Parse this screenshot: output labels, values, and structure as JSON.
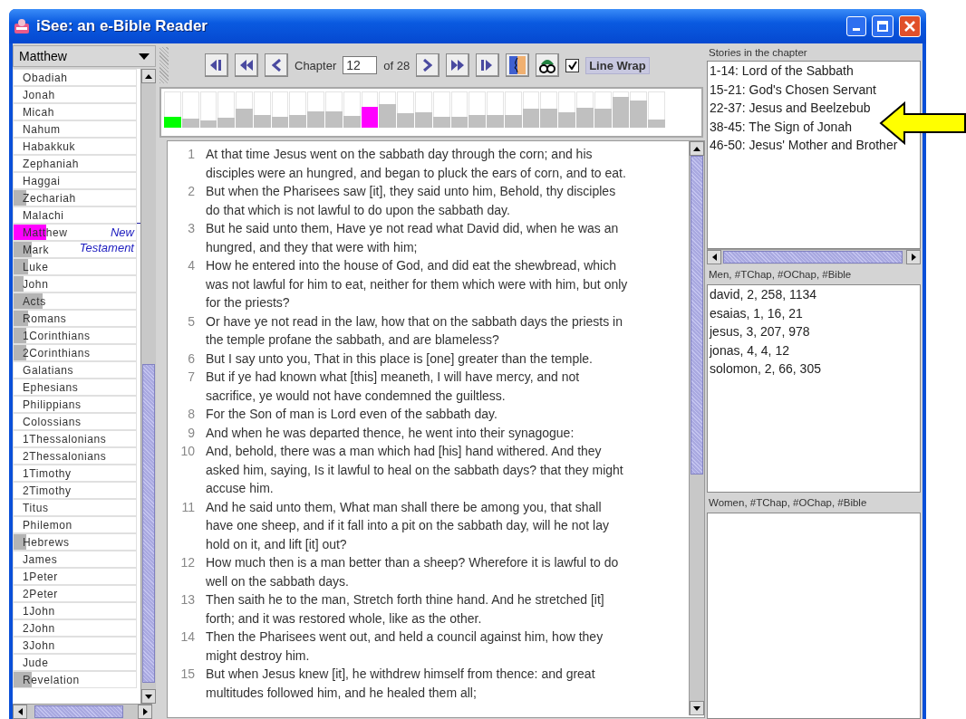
{
  "window": {
    "title": "iSee: an e-Bible Reader"
  },
  "book_selector": {
    "value": "Matthew"
  },
  "books": [
    {
      "name": "Obadiah",
      "selected": false
    },
    {
      "name": "Jonah",
      "selected": false
    },
    {
      "name": "Micah",
      "selected": false
    },
    {
      "name": "Nahum",
      "selected": false
    },
    {
      "name": "Habakkuk",
      "selected": false
    },
    {
      "name": "Zephaniah",
      "selected": false
    },
    {
      "name": "Haggai",
      "selected": false
    },
    {
      "name": "Zechariah",
      "level": 0.1,
      "selected": false
    },
    {
      "name": "Malachi",
      "selected": false
    },
    {
      "name": "Matthew",
      "level": 0.27,
      "selected": true,
      "section_start": "New Testament"
    },
    {
      "name": "Mark",
      "level": 0.15,
      "selected": false
    },
    {
      "name": "Luke",
      "level": 0.12,
      "selected": false
    },
    {
      "name": "John",
      "level": 0.08,
      "selected": false
    },
    {
      "name": "Acts",
      "level": 0.24,
      "selected": false
    },
    {
      "name": "Romans",
      "level": 0.12,
      "selected": false
    },
    {
      "name": "1Corinthians",
      "level": 0.1,
      "selected": false
    },
    {
      "name": "2Corinthians",
      "level": 0.1,
      "selected": false
    },
    {
      "name": "Galatians",
      "selected": false
    },
    {
      "name": "Ephesians",
      "selected": false
    },
    {
      "name": "Philippians",
      "selected": false
    },
    {
      "name": "Colossians",
      "selected": false
    },
    {
      "name": "1Thessalonians",
      "selected": false
    },
    {
      "name": "2Thessalonians",
      "selected": false
    },
    {
      "name": "1Timothy",
      "selected": false
    },
    {
      "name": "2Timothy",
      "selected": false
    },
    {
      "name": "Titus",
      "selected": false
    },
    {
      "name": "Philemon",
      "selected": false
    },
    {
      "name": "Hebrews",
      "level": 0.1,
      "selected": false
    },
    {
      "name": "James",
      "selected": false
    },
    {
      "name": "1Peter",
      "selected": false
    },
    {
      "name": "2Peter",
      "selected": false
    },
    {
      "name": "1John",
      "selected": false
    },
    {
      "name": "2John",
      "selected": false
    },
    {
      "name": "3John",
      "selected": false
    },
    {
      "name": "Jude",
      "selected": false
    },
    {
      "name": "Revelation",
      "level": 0.15,
      "selected": false
    }
  ],
  "toolbar": {
    "buttons_left": [
      {
        "kind": "first"
      },
      {
        "kind": "rewind"
      },
      {
        "kind": "back"
      }
    ],
    "chapter_label": "Chapter",
    "chapter_value": "12",
    "chapter_total": "of 28",
    "buttons_right": [
      {
        "kind": "forward"
      },
      {
        "kind": "fastforward"
      },
      {
        "kind": "last"
      },
      {
        "kind": "face"
      },
      {
        "kind": "binoculars"
      }
    ],
    "line_wrap": {
      "label": "Line Wrap",
      "checked": true
    }
  },
  "chapters": [
    {
      "level": 0.29,
      "color": "#00ff00"
    },
    {
      "level": 0.24,
      "color": "#c0c0c0"
    },
    {
      "level": 0.21,
      "color": "#c0c0c0"
    },
    {
      "level": 0.27,
      "color": "#c0c0c0"
    },
    {
      "level": 0.52,
      "color": "#c0c0c0"
    },
    {
      "level": 0.35,
      "color": "#c0c0c0"
    },
    {
      "level": 0.3,
      "color": "#c0c0c0"
    },
    {
      "level": 0.35,
      "color": "#c0c0c0"
    },
    {
      "level": 0.45,
      "color": "#c0c0c0"
    },
    {
      "level": 0.45,
      "color": "#c0c0c0"
    },
    {
      "level": 0.33,
      "color": "#c0c0c0"
    },
    {
      "level": 0.57,
      "color": "#ff00ff"
    },
    {
      "level": 0.65,
      "color": "#c0c0c0"
    },
    {
      "level": 0.4,
      "color": "#c0c0c0"
    },
    {
      "level": 0.43,
      "color": "#c0c0c0"
    },
    {
      "level": 0.3,
      "color": "#c0c0c0"
    },
    {
      "level": 0.29,
      "color": "#c0c0c0"
    },
    {
      "level": 0.35,
      "color": "#c0c0c0"
    },
    {
      "level": 0.35,
      "color": "#c0c0c0"
    },
    {
      "level": 0.35,
      "color": "#c0c0c0"
    },
    {
      "level": 0.52,
      "color": "#c0c0c0"
    },
    {
      "level": 0.52,
      "color": "#c0c0c0"
    },
    {
      "level": 0.43,
      "color": "#c0c0c0"
    },
    {
      "level": 0.55,
      "color": "#c0c0c0"
    },
    {
      "level": 0.52,
      "color": "#c0c0c0"
    },
    {
      "level": 0.84,
      "color": "#c0c0c0"
    },
    {
      "level": 0.74,
      "color": "#c0c0c0"
    },
    {
      "level": 0.22,
      "color": "#c0c0c0"
    }
  ],
  "verses": [
    {
      "number": "1",
      "text": "At that time Jesus went on the sabbath day through the corn; and his disciples were an hungred, and began to pluck the ears of corn, and to eat."
    },
    {
      "number": "2",
      "text": "But when the Pharisees saw [it], they said unto him, Behold, thy disciples do that which is not lawful to do upon the sabbath day."
    },
    {
      "number": "3",
      "text": "But he said unto them, Have ye not read what David did, when he was an hungred, and they that were with him;"
    },
    {
      "number": "4",
      "text": "How he entered into the house of God, and did eat the shewbread, which was not lawful for him to eat, neither for them which were with him, but only for the priests?"
    },
    {
      "number": "5",
      "text": "Or have ye not read in the law, how that on the sabbath days the priests in the temple profane the sabbath, and are blameless?"
    },
    {
      "number": "6",
      "text": "But I say unto you, That in this place is [one] greater than the temple."
    },
    {
      "number": "7",
      "text": "But if ye had known what [this] meaneth, I will have mercy, and not sacrifice, ye would not have condemned the guiltless."
    },
    {
      "number": "8",
      "text": "For the Son of man is Lord even of the sabbath day."
    },
    {
      "number": "9",
      "text": "And when he was departed thence, he went into their synagogue:"
    },
    {
      "number": "10",
      "text": "And, behold, there was a man which had [his] hand withered. And they asked him, saying, Is it lawful to heal on the sabbath days? that they might accuse him."
    },
    {
      "number": "11",
      "text": "And he said unto them, What man shall there be among you, that shall have one sheep, and if it fall into a pit on the sabbath day, will he not lay hold on it, and lift [it] out?"
    },
    {
      "number": "12",
      "text": "How much then is a man better than a sheep? Wherefore it is lawful to do well on the sabbath days."
    },
    {
      "number": "13",
      "text": "Then saith he to the man, Stretch forth thine hand. And he stretched [it] forth; and it was restored whole, like as the other."
    },
    {
      "number": "14",
      "text": "Then the Pharisees went out, and held a council against him, how they might destroy him."
    },
    {
      "number": "15",
      "text": "But when Jesus knew [it], he withdrew himself from thence: and great multitudes followed him, and he healed them all;"
    }
  ],
  "stories": {
    "header": "Stories in the chapter",
    "items": [
      "1-14: Lord of the Sabbath",
      "15-21: God's Chosen Servant",
      "22-37: Jesus and Beelzebub",
      "38-45: The Sign of Jonah",
      "46-50: Jesus' Mother and Brother"
    ]
  },
  "men": {
    "header": "Men, #TChap, #OChap, #Bible",
    "items": [
      "david, 2, 258, 1134",
      "esaias, 1, 16, 21",
      "jesus, 3, 207, 978",
      "jonas, 4, 4, 12",
      "solomon, 2, 66, 305"
    ]
  },
  "women": {
    "header": "Women, #TChap, #OChap, #Bible"
  },
  "annotation": {
    "kind": "arrow"
  }
}
